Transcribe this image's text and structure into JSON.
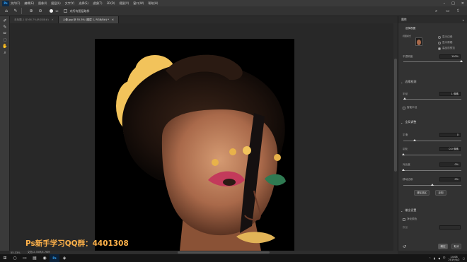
{
  "menubar": {
    "logo": "Ps",
    "items": [
      "文件(F)",
      "编辑(E)",
      "图像(I)",
      "图层(L)",
      "文字(Y)",
      "选择(S)",
      "滤镜(T)",
      "3D(D)",
      "视图(V)",
      "窗口(W)",
      "帮助(H)"
    ],
    "win_controls": [
      "–",
      "□",
      "✕"
    ]
  },
  "optionsbar": {
    "sample_all_layers": "对所有图层取样",
    "brush_size": "10"
  },
  "tabs": [
    {
      "label": "未标题-1 @ 66.7%(RGB/8#)",
      "close": "✕"
    },
    {
      "label": "人像.jpg @ 55.3% (图层 1, RGB/8#) *",
      "close": "✕"
    }
  ],
  "status": {
    "zoom": "55.33%",
    "doc": "文档:2.35M/4.76M"
  },
  "watermark": "Ps新手学习QQ群：4401308",
  "panel": {
    "title": "属性",
    "close": "»",
    "mode_title": "选择视图",
    "view_mode_label": "视图模式",
    "show_edge": "显示边缘",
    "show_original": "显示原稿",
    "hq_preview": "高品质预览",
    "transparency_label": "不透明度",
    "transparency_value": "100%",
    "edge_detect": "边缘检测",
    "radius_label": "半径",
    "radius_value": "1 像素",
    "smart_radius": "智能半径",
    "global_refine": "全局调整",
    "smooth_label": "平滑",
    "smooth_value": "0",
    "feather_label": "羽化",
    "feather_value": "0.0 像素",
    "contrast_label": "对比度",
    "contrast_value": "0%",
    "shift_label": "移动边缘",
    "shift_value": "0%",
    "clear_btn": "清除选区",
    "invert_btn": "反相",
    "output_title": "输出设置",
    "decontam": "净化颜色",
    "amount_label": "数量",
    "ok": "确定",
    "cancel": "取消"
  },
  "taskbar": {
    "ps": "Ps",
    "time": "14:08",
    "date": "2019/4/2",
    "lang": "中"
  },
  "sliders": {
    "transparency": 1.0,
    "radius": 0.02,
    "smooth": 0.2,
    "feather": 0.0,
    "contrast": 0.0,
    "shift": 0.5
  }
}
